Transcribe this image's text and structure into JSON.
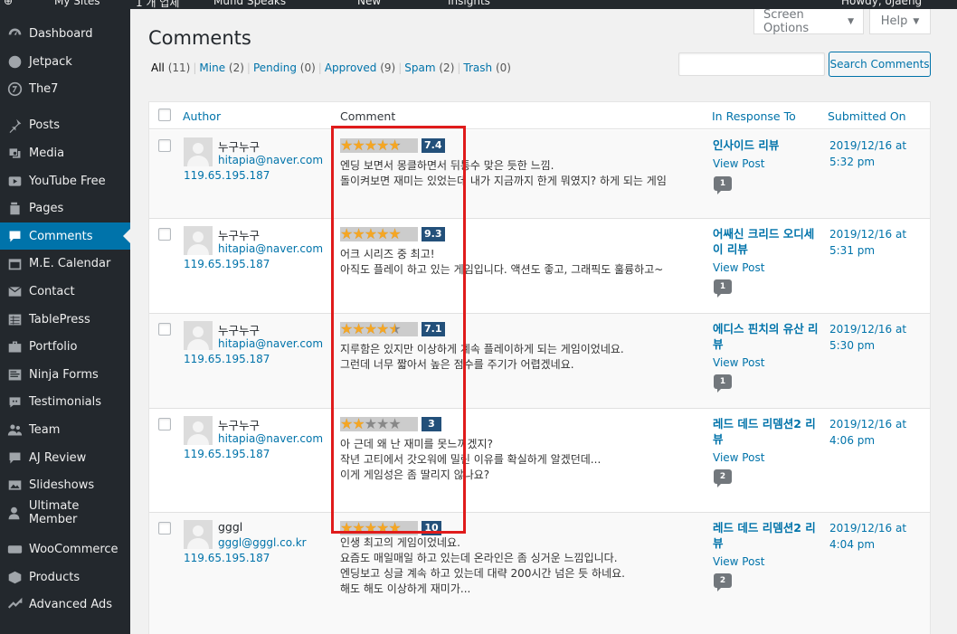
{
  "admin_bar": {
    "items": [
      "My Sites",
      "1 개 업체",
      "Mufid Speaks",
      "",
      "New",
      "",
      "Insights",
      "Howdy, ojaeng"
    ]
  },
  "sidebar": {
    "items": [
      {
        "label": "Dashboard",
        "icon": "dashboard-icon"
      },
      {
        "label": "Jetpack",
        "icon": "jetpack-icon"
      },
      {
        "label": "The7",
        "icon": "the7-icon"
      },
      {
        "label": "Posts",
        "icon": "pin-icon"
      },
      {
        "label": "Media",
        "icon": "media-icon"
      },
      {
        "label": "YouTube Free",
        "icon": "youtube-icon"
      },
      {
        "label": "Pages",
        "icon": "pages-icon"
      },
      {
        "label": "Comments",
        "icon": "comments-icon",
        "active": true
      },
      {
        "label": "M.E. Calendar",
        "icon": "calendar-icon"
      },
      {
        "label": "Contact",
        "icon": "envelope-icon"
      },
      {
        "label": "TablePress",
        "icon": "table-icon"
      },
      {
        "label": "Portfolio",
        "icon": "portfolio-icon"
      },
      {
        "label": "Ninja Forms",
        "icon": "forms-icon"
      },
      {
        "label": "Testimonials",
        "icon": "testimonial-icon"
      },
      {
        "label": "Team",
        "icon": "team-icon"
      },
      {
        "label": "AJ Review",
        "icon": "review-icon"
      },
      {
        "label": "Slideshows",
        "icon": "slideshow-icon"
      },
      {
        "label": "Ultimate Member",
        "icon": "user-icon"
      },
      {
        "label": "WooCommerce",
        "icon": "woocommerce-icon"
      },
      {
        "label": "Products",
        "icon": "products-icon"
      },
      {
        "label": "Advanced Ads",
        "icon": "ads-icon"
      }
    ]
  },
  "header": {
    "title": "Comments",
    "screen_options": "Screen Options",
    "help": "Help"
  },
  "filters": [
    {
      "label": "All",
      "count": "(11)",
      "current": true
    },
    {
      "label": "Mine",
      "count": "(2)"
    },
    {
      "label": "Pending",
      "count": "(0)"
    },
    {
      "label": "Approved",
      "count": "(9)"
    },
    {
      "label": "Spam",
      "count": "(2)"
    },
    {
      "label": "Trash",
      "count": "(0)"
    }
  ],
  "search": {
    "value": "",
    "button": "Search Comments"
  },
  "table": {
    "columns": {
      "author": "Author",
      "comment": "Comment",
      "in_response_to": "In Response To",
      "submitted_on": "Submitted On"
    },
    "view_post_label": "View Post",
    "rows": [
      {
        "author": "누구누구",
        "email": "hitapia@naver.com",
        "ip": "119.65.195.187",
        "rating": 7.4,
        "score": "7.4",
        "lines": [
          "엔딩 보면서 몽클하면서 뒤통수 맞은 듯한 느낌.",
          "돌이켜보면 재미는 있었는데 내가 지금까지 한게 뭐였지? 하게 되는 게임"
        ],
        "post_title": "인사이드 리뷰",
        "comment_count": "1",
        "submitted": "2019/12/16 at 5:32 pm"
      },
      {
        "author": "누구누구",
        "email": "hitapia@naver.com",
        "ip": "119.65.195.187",
        "rating": 9.3,
        "score": "9.3",
        "lines": [
          "어크 시리즈 중 최고!",
          "아직도 플레이 하고 있는 게임입니다. 액션도 좋고, 그래픽도 훌륭하고~"
        ],
        "post_title": "어쌔신 크리드 오디세이 리뷰",
        "comment_count": "1",
        "submitted": "2019/12/16 at 5:31 pm"
      },
      {
        "author": "누구누구",
        "email": "hitapia@naver.com",
        "ip": "119.65.195.187",
        "rating": 7.1,
        "score": "7.1",
        "lines": [
          "지루함은 있지만 이상하게 계속 플레이하게 되는 게임이었네요.",
          "그런데 너무 짧아서 높은 점수를 주기가 어렵겠네요."
        ],
        "post_title": "에디스 핀치의 유산 리뷰",
        "comment_count": "1",
        "submitted": "2019/12/16 at 5:30 pm"
      },
      {
        "author": "누구누구",
        "email": "hitapia@naver.com",
        "ip": "119.65.195.187",
        "rating": 3,
        "score": "3",
        "lines": [
          "아 근데 왜 난 재미를 못느끼겠지?",
          "작년 고티에서 갓오워에 밀린 이유를 확실하게 알겠던데...",
          "이게 게임성은 좀 딸리지 않나요?"
        ],
        "post_title": "레드 데드 리뎀션2 리뷰",
        "comment_count": "2",
        "submitted": "2019/12/16 at 4:06 pm"
      },
      {
        "author": "gggl",
        "email": "gggl@gggl.co.kr",
        "ip": "119.65.195.187",
        "rating": 10,
        "score": "10",
        "lines": [
          "인생 최고의 게임이었네요.",
          "요즘도 매일매일 하고 있는데 온라인은 좀 싱거운 느낌입니다.",
          "엔딩보고 싱글 계속 하고 있는데 대략 200시간 넘은 듯 하네요.",
          "해도 해도 이상하게 재미가..."
        ],
        "post_title": "레드 데드 리뎀션2 리뷰",
        "comment_count": "2",
        "submitted": "2019/12/16 at 4:04 pm"
      }
    ]
  }
}
